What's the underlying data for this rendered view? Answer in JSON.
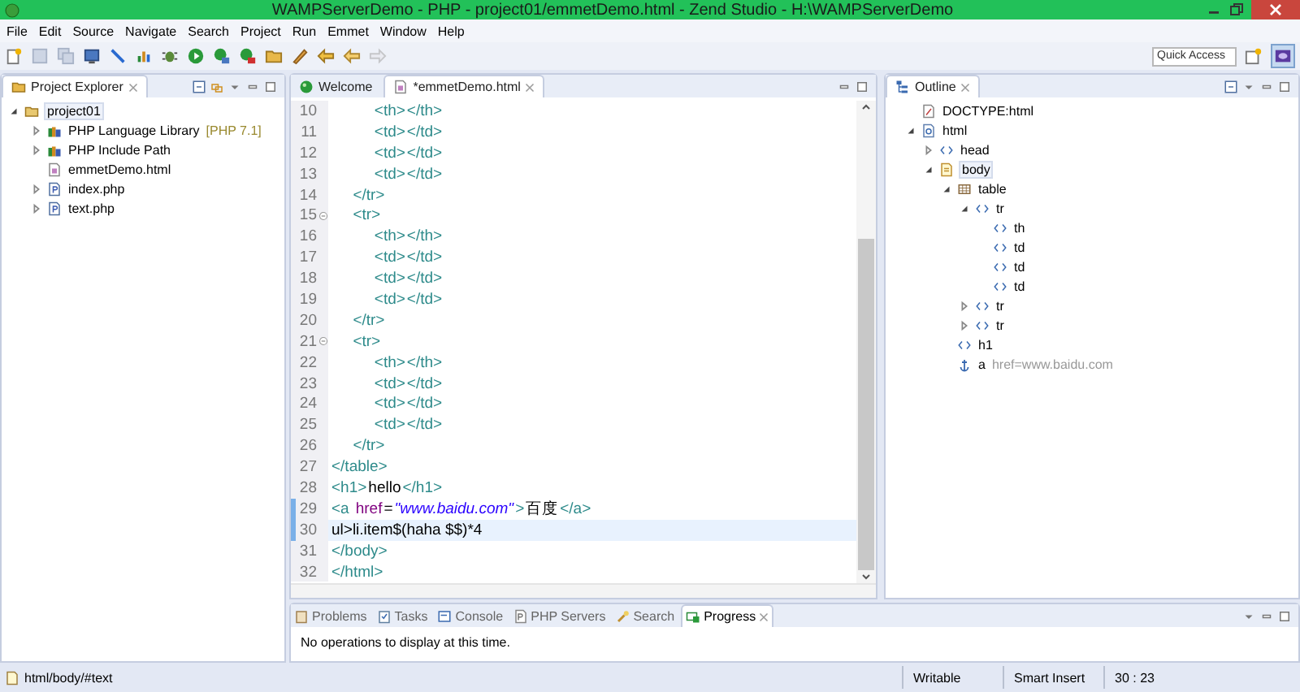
{
  "window": {
    "title": "WAMPServerDemo - PHP - project01/emmetDemo.html - Zend Studio - H:\\WAMPServerDemo"
  },
  "menu": [
    "File",
    "Edit",
    "Source",
    "Navigate",
    "Search",
    "Project",
    "Run",
    "Emmet",
    "Window",
    "Help"
  ],
  "quick_access": {
    "placeholder": "Quick Access"
  },
  "project_explorer": {
    "title": "Project Explorer",
    "items": [
      {
        "label": "project01",
        "kind": "project",
        "expanded": true,
        "selected": true,
        "children": [
          {
            "label": "PHP Language Library",
            "detail": "[PHP 7.1]",
            "kind": "library",
            "expanded": false,
            "selected": false
          },
          {
            "label": "PHP Include Path",
            "kind": "library",
            "expanded": false,
            "selected": false
          },
          {
            "label": "emmetDemo.html",
            "kind": "html",
            "selected": false
          },
          {
            "label": "index.php",
            "kind": "php",
            "expanded": false,
            "selected": false
          },
          {
            "label": "text.php",
            "kind": "php",
            "expanded": false,
            "selected": false
          }
        ]
      }
    ]
  },
  "editor": {
    "tabs": [
      {
        "label": "Welcome",
        "kind": "welcome",
        "selected": false
      },
      {
        "label": "*emmetDemo.html",
        "kind": "html",
        "selected": true
      }
    ],
    "lines": [
      {
        "number": "10",
        "tokens": [
          {
            "kind": "tag",
            "text": "          <th>"
          },
          {
            "kind": "tag",
            "text": "</th>"
          }
        ]
      },
      {
        "number": "11",
        "tokens": [
          {
            "kind": "tag",
            "text": "          <td>"
          },
          {
            "kind": "tag",
            "text": "</td>"
          }
        ]
      },
      {
        "number": "12",
        "tokens": [
          {
            "kind": "tag",
            "text": "          <td>"
          },
          {
            "kind": "tag",
            "text": "</td>"
          }
        ]
      },
      {
        "number": "13",
        "tokens": [
          {
            "kind": "tag",
            "text": "          <td>"
          },
          {
            "kind": "tag",
            "text": "</td>"
          }
        ]
      },
      {
        "number": "14",
        "tokens": [
          {
            "kind": "tag",
            "text": "     </tr>"
          }
        ]
      },
      {
        "number": "15",
        "fold": true,
        "tokens": [
          {
            "kind": "tag",
            "text": "     <tr>"
          }
        ]
      },
      {
        "number": "16",
        "tokens": [
          {
            "kind": "tag",
            "text": "          <th>"
          },
          {
            "kind": "tag",
            "text": "</th>"
          }
        ]
      },
      {
        "number": "17",
        "tokens": [
          {
            "kind": "tag",
            "text": "          <td>"
          },
          {
            "kind": "tag",
            "text": "</td>"
          }
        ]
      },
      {
        "number": "18",
        "tokens": [
          {
            "kind": "tag",
            "text": "          <td>"
          },
          {
            "kind": "tag",
            "text": "</td>"
          }
        ]
      },
      {
        "number": "19",
        "tokens": [
          {
            "kind": "tag",
            "text": "          <td>"
          },
          {
            "kind": "tag",
            "text": "</td>"
          }
        ]
      },
      {
        "number": "20",
        "tokens": [
          {
            "kind": "tag",
            "text": "     </tr>"
          }
        ]
      },
      {
        "number": "21",
        "fold": true,
        "tokens": [
          {
            "kind": "tag",
            "text": "     <tr>"
          }
        ]
      },
      {
        "number": "22",
        "tokens": [
          {
            "kind": "tag",
            "text": "          <th>"
          },
          {
            "kind": "tag",
            "text": "</th>"
          }
        ]
      },
      {
        "number": "23",
        "tokens": [
          {
            "kind": "tag",
            "text": "          <td>"
          },
          {
            "kind": "tag",
            "text": "</td>"
          }
        ]
      },
      {
        "number": "24",
        "tokens": [
          {
            "kind": "tag",
            "text": "          <td>"
          },
          {
            "kind": "tag",
            "text": "</td>"
          }
        ]
      },
      {
        "number": "25",
        "tokens": [
          {
            "kind": "tag",
            "text": "          <td>"
          },
          {
            "kind": "tag",
            "text": "</td>"
          }
        ]
      },
      {
        "number": "26",
        "tokens": [
          {
            "kind": "tag",
            "text": "     </tr>"
          }
        ]
      },
      {
        "number": "27",
        "tokens": [
          {
            "kind": "tag",
            "text": "</table>"
          }
        ]
      },
      {
        "number": "28",
        "tokens": [
          {
            "kind": "tag",
            "text": "<h1>"
          },
          {
            "kind": "text",
            "text": "hello"
          },
          {
            "kind": "tag",
            "text": "</h1>"
          }
        ]
      },
      {
        "number": "29",
        "changed": true,
        "tokens": [
          {
            "kind": "tag",
            "text": "<a"
          },
          {
            "kind": "attr",
            "text": "href"
          },
          {
            "kind": "text",
            "text": "="
          },
          {
            "kind": "string",
            "text": "\"www.baidu.com\""
          },
          {
            "kind": "tag",
            "text": ">"
          },
          {
            "kind": "text",
            "text": "百度"
          },
          {
            "kind": "tag",
            "text": "</a>"
          }
        ]
      },
      {
        "number": "30",
        "changed": true,
        "current": true,
        "tokens": [
          {
            "kind": "text",
            "text": "ul>li.item$(haha $$)*4"
          }
        ]
      },
      {
        "number": "31",
        "tokens": [
          {
            "kind": "tag",
            "text": "</body>"
          }
        ]
      },
      {
        "number": "32",
        "tokens": [
          {
            "kind": "tag",
            "text": "</html>"
          }
        ]
      }
    ]
  },
  "outline": {
    "title": "Outline",
    "items": [
      {
        "label": "DOCTYPE:html",
        "kind": "doctype"
      },
      {
        "label": "html",
        "kind": "html",
        "expanded": true,
        "children": [
          {
            "label": "head",
            "kind": "element",
            "expanded": false
          },
          {
            "label": "body",
            "kind": "body",
            "expanded": true,
            "selected": true,
            "children": [
              {
                "label": "table",
                "kind": "table",
                "expanded": true,
                "children": [
                  {
                    "label": "tr",
                    "kind": "element",
                    "expanded": true,
                    "children": [
                      {
                        "label": "th",
                        "kind": "element"
                      },
                      {
                        "label": "td",
                        "kind": "element"
                      },
                      {
                        "label": "td",
                        "kind": "element"
                      },
                      {
                        "label": "td",
                        "kind": "element"
                      }
                    ]
                  },
                  {
                    "label": "tr",
                    "kind": "element",
                    "expanded": false
                  },
                  {
                    "label": "tr",
                    "kind": "element",
                    "expanded": false
                  }
                ]
              },
              {
                "label": "h1",
                "kind": "element"
              },
              {
                "label": "a",
                "detail": "href=www.baidu.com",
                "kind": "anchor"
              }
            ]
          }
        ]
      }
    ]
  },
  "bottom_panel": {
    "tabs": [
      {
        "label": "Problems",
        "kind": "problems",
        "selected": false
      },
      {
        "label": "Tasks",
        "kind": "tasks",
        "selected": false
      },
      {
        "label": "Console",
        "kind": "console",
        "selected": false
      },
      {
        "label": "PHP Servers",
        "kind": "servers",
        "selected": false
      },
      {
        "label": "Search",
        "kind": "search",
        "selected": false
      },
      {
        "label": "Progress",
        "kind": "progress",
        "selected": true
      }
    ],
    "message": "No operations to display at this time."
  },
  "status_bar": {
    "path": "html/body/#text",
    "mode": "Writable",
    "insert": "Smart Insert",
    "position": "30 : 23"
  }
}
